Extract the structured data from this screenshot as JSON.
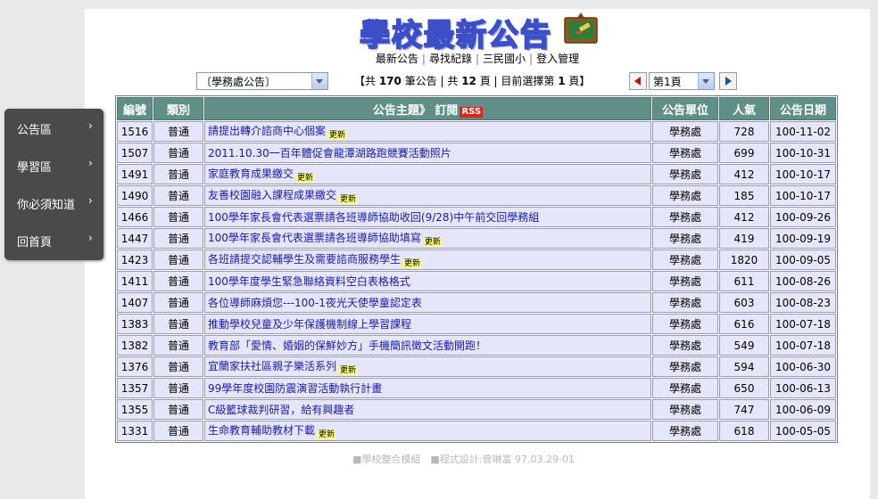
{
  "header": {
    "title": "學校最新公告",
    "icon": "bulletin-board-icon",
    "nav": [
      "最新公告",
      "尋找紀錄",
      "三民國小",
      "登入管理"
    ]
  },
  "toolbar": {
    "category_selected": "〔學務處公告〕",
    "summary_prefix": "【共 ",
    "summary_total": "170",
    "summary_mid1": " 筆公告 | 共 ",
    "summary_pages": "12",
    "summary_mid2": " 頁 | 目前選擇第 ",
    "summary_current": "1",
    "summary_suffix": " 頁】",
    "page_selected": "第1頁"
  },
  "table": {
    "headers": {
      "no": "編號",
      "category": "類別",
      "subject": "公告主題》 訂閱",
      "rss": "RSS",
      "unit": "公告單位",
      "views": "人氣",
      "date": "公告日期"
    },
    "new_badge": "更新",
    "rows": [
      {
        "no": "1516",
        "category": "普通",
        "subject": "請提出轉介諮商中心個案",
        "unit": "學務處",
        "views": "728",
        "date": "100-11-02",
        "new": true
      },
      {
        "no": "1507",
        "category": "普通",
        "subject": "2011.10.30一百年體促會龍潭湖路跑競賽活動照片",
        "unit": "學務處",
        "views": "699",
        "date": "100-10-31",
        "new": false
      },
      {
        "no": "1491",
        "category": "普通",
        "subject": "家庭教育成果繳交",
        "unit": "學務處",
        "views": "412",
        "date": "100-10-17",
        "new": true
      },
      {
        "no": "1490",
        "category": "普通",
        "subject": "友善校園融入課程成果繳交",
        "unit": "學務處",
        "views": "185",
        "date": "100-10-17",
        "new": true
      },
      {
        "no": "1466",
        "category": "普通",
        "subject": "100學年家長會代表選票請各班導師協助收回(9/28)中午前交回學務組",
        "unit": "學務處",
        "views": "412",
        "date": "100-09-26",
        "new": false
      },
      {
        "no": "1447",
        "category": "普通",
        "subject": "100學年家長會代表選票請各班導師協助填寫",
        "unit": "學務處",
        "views": "419",
        "date": "100-09-19",
        "new": true
      },
      {
        "no": "1423",
        "category": "普通",
        "subject": "各班請提交認輔學生及需要諮商服務學生",
        "unit": "學務處",
        "views": "1820",
        "date": "100-09-05",
        "new": true
      },
      {
        "no": "1411",
        "category": "普通",
        "subject": "100學年度學生緊急聯絡資料空白表格格式",
        "unit": "學務處",
        "views": "611",
        "date": "100-08-26",
        "new": false
      },
      {
        "no": "1407",
        "category": "普通",
        "subject": "各位導師麻煩您---100-1夜光天使學童認定表",
        "unit": "學務處",
        "views": "603",
        "date": "100-08-23",
        "new": false
      },
      {
        "no": "1383",
        "category": "普通",
        "subject": "推動學校兒童及少年保護機制線上學習課程",
        "unit": "學務處",
        "views": "616",
        "date": "100-07-18",
        "new": false
      },
      {
        "no": "1382",
        "category": "普通",
        "subject": "教育部「愛情、婚姻的保鮮妙方」手機簡訊徵文活動開跑！",
        "unit": "學務處",
        "views": "549",
        "date": "100-07-18",
        "new": false
      },
      {
        "no": "1376",
        "category": "普通",
        "subject": "宜蘭家扶社區親子樂活系列",
        "unit": "學務處",
        "views": "594",
        "date": "100-06-30",
        "new": true
      },
      {
        "no": "1357",
        "category": "普通",
        "subject": "99學年度校園防震演習活動執行計畫",
        "unit": "學務處",
        "views": "650",
        "date": "100-06-13",
        "new": false
      },
      {
        "no": "1355",
        "category": "普通",
        "subject": "C級籃球裁判研習，給有興趣者",
        "unit": "學務處",
        "views": "747",
        "date": "100-06-09",
        "new": false
      },
      {
        "no": "1331",
        "category": "普通",
        "subject": "生命教育輔助教材下載",
        "unit": "學務處",
        "views": "618",
        "date": "100-05-05",
        "new": true
      }
    ]
  },
  "footer": {
    "text": "■學校整合模組　■程式設計:曾琳富 97.03.29-01"
  },
  "sidebar": {
    "items": [
      {
        "label": "公告區"
      },
      {
        "label": "學習區"
      },
      {
        "label": "你必須知道"
      },
      {
        "label": "回首頁"
      }
    ],
    "chevron": "›"
  }
}
